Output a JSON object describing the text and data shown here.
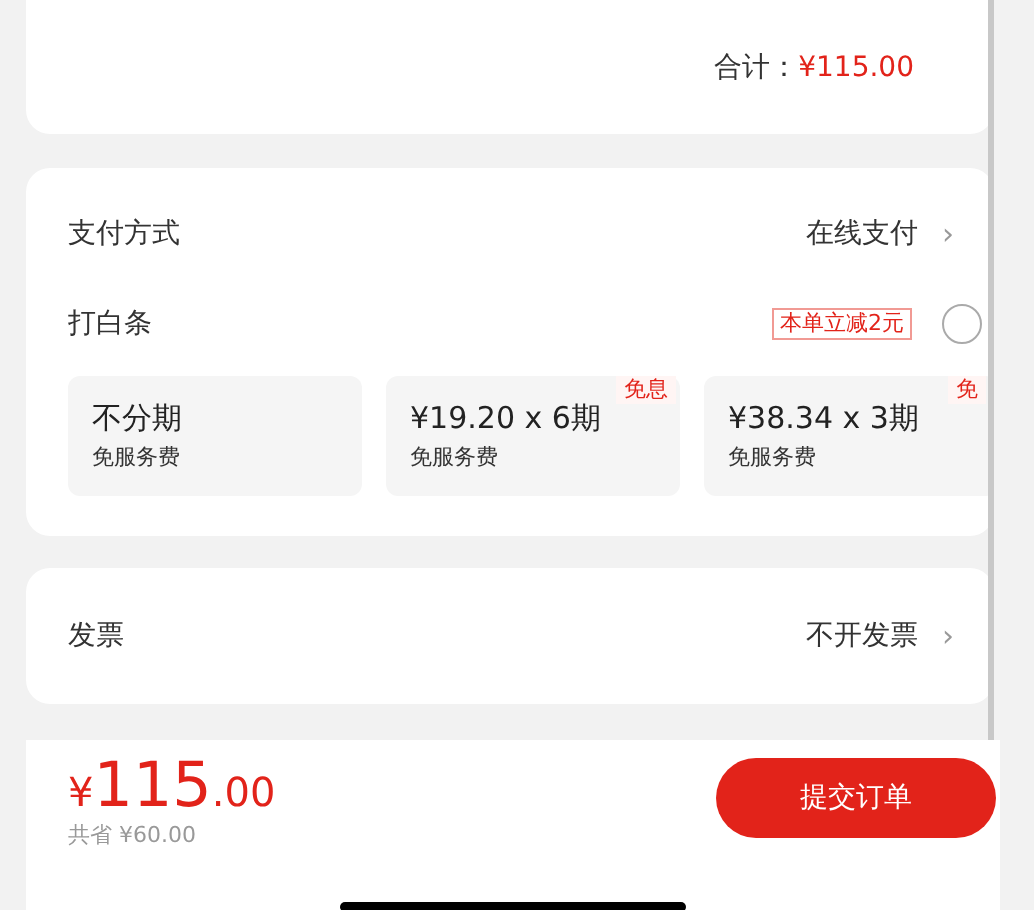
{
  "total": {
    "label": "合计：",
    "amount": "¥115.00"
  },
  "payment": {
    "label": "支付方式",
    "value": "在线支付",
    "chevron": "›"
  },
  "baitiao": {
    "label": "打白条",
    "promo": "本单立减2元",
    "checked": false,
    "plans": [
      {
        "title": "不分期",
        "note": "免服务费",
        "selected": false
      },
      {
        "title": "¥19.20 x 6期",
        "note": "免服务费",
        "badge": "免息",
        "selected": false
      },
      {
        "title": "¥38.34 x 3期",
        "note": "免服务费",
        "badge": "免",
        "selected": false
      }
    ]
  },
  "invoice": {
    "label": "发票",
    "value": "不开发票",
    "chevron": "›"
  },
  "footer": {
    "currency": "¥",
    "integer": "115",
    "decimals": ".00",
    "saved": "共省 ¥60.00",
    "submit": "提交订单"
  }
}
